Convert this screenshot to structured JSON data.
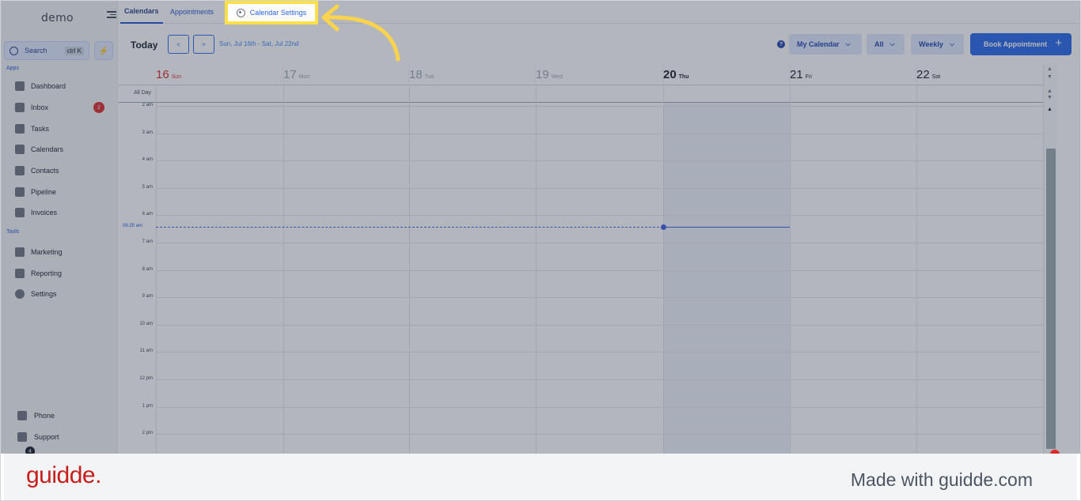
{
  "sidebar": {
    "logo": "demo",
    "search": {
      "label": "Search",
      "shortcut": "ctrl K"
    },
    "sections": {
      "apps": "Apps",
      "tools": "Tools"
    },
    "apps": [
      {
        "label": "Dashboard",
        "icon": "grid-icon"
      },
      {
        "label": "Inbox",
        "icon": "inbox-icon",
        "badge": "2"
      },
      {
        "label": "Tasks",
        "icon": "clipboard-icon"
      },
      {
        "label": "Calendars",
        "icon": "calendar-icon"
      },
      {
        "label": "Contacts",
        "icon": "person-icon"
      },
      {
        "label": "Pipeline",
        "icon": "funnel-icon"
      },
      {
        "label": "Invoices",
        "icon": "invoice-icon"
      }
    ],
    "tools": [
      {
        "label": "Marketing",
        "icon": "megaphone-icon"
      },
      {
        "label": "Reporting",
        "icon": "pie-chart-icon"
      },
      {
        "label": "Settings",
        "icon": "gear-icon"
      }
    ],
    "bottom": [
      {
        "label": "Phone",
        "icon": "phone-icon"
      },
      {
        "label": "Support",
        "icon": "chat-icon"
      }
    ],
    "notification_count": "4"
  },
  "tabs": {
    "calendars": "Calendars",
    "appointments": "Appointments",
    "settings": "Calendar Settings"
  },
  "toolbar": {
    "today": "Today",
    "prev": "<",
    "next": ">",
    "range": "Sun, Jul 16th - Sat, Jul 22nd",
    "help": "?",
    "calendar_select": "My Calendar",
    "filter_select": "All",
    "view_select": "Weekly",
    "book_button": "Book Appointment",
    "book_plus": "+"
  },
  "calendar": {
    "days": [
      {
        "num": "16",
        "name": "Sun"
      },
      {
        "num": "17",
        "name": "Mon"
      },
      {
        "num": "18",
        "name": "Tue"
      },
      {
        "num": "19",
        "name": "Wed"
      },
      {
        "num": "20",
        "name": "Thu"
      },
      {
        "num": "21",
        "name": "Fri"
      },
      {
        "num": "22",
        "name": "Sat"
      }
    ],
    "all_day": "All Day",
    "hours": [
      "2 am",
      "3 am",
      "4 am",
      "5 am",
      "6 am",
      "7 am",
      "8 am",
      "9 am",
      "10 am",
      "11 am",
      "12 pm",
      "1 pm",
      "2 pm"
    ],
    "now_label": "06:25 am",
    "today_index": 4
  },
  "footer": {
    "brand": "guidde.",
    "made_with": "Made with guidde.com"
  },
  "colors": {
    "accent": "#2563eb",
    "highlight": "#fde047",
    "brand": "#c81e1e",
    "badge": "#dc2626"
  }
}
